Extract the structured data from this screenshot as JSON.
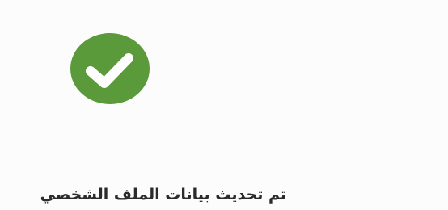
{
  "dialog": {
    "icon": "check-circle-icon",
    "accent_color": "#5a9a3b",
    "message": "تم تحديث بيانات الملف الشخصي"
  }
}
